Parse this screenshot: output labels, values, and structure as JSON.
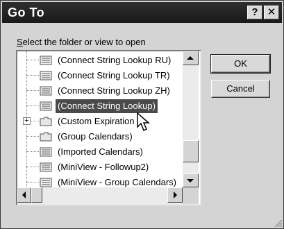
{
  "window": {
    "title": "Go To",
    "help_label": "?",
    "close_label": "✕"
  },
  "prompt": {
    "accel": "S",
    "rest": "elect the folder or view to open"
  },
  "tree": {
    "items": [
      {
        "label": "(Connect String Lookup RU)",
        "icon": "view-icon",
        "selected": false
      },
      {
        "label": "(Connect String Lookup TR)",
        "icon": "view-icon",
        "selected": false
      },
      {
        "label": "(Connect String Lookup ZH)",
        "icon": "view-icon",
        "selected": false
      },
      {
        "label": "(Connect String Lookup)",
        "icon": "view-icon",
        "selected": true
      },
      {
        "label": "(Custom Expiration",
        "icon": "folder-icon",
        "selected": false,
        "expander": "+"
      },
      {
        "label": "(Group Calendars)",
        "icon": "folder-icon",
        "selected": false
      },
      {
        "label": "(Imported Calendars)",
        "icon": "view-icon",
        "selected": false
      },
      {
        "label": "(MiniView - Followup2)",
        "icon": "view-icon",
        "selected": false
      },
      {
        "label": "(MiniView - Group Calendars)",
        "icon": "view-icon",
        "selected": false
      }
    ]
  },
  "buttons": {
    "ok_label": "OK",
    "cancel_label": "Cancel"
  },
  "scroll": {
    "up_icon": "arrow-up-icon",
    "down_icon": "arrow-down-icon",
    "left_icon": "arrow-left-icon",
    "right_icon": "arrow-right-icon"
  },
  "colors": {
    "title_bar": "#1f1f1f",
    "selection": "#4a4a4a",
    "dialog_bg": "#d4d4d4"
  }
}
